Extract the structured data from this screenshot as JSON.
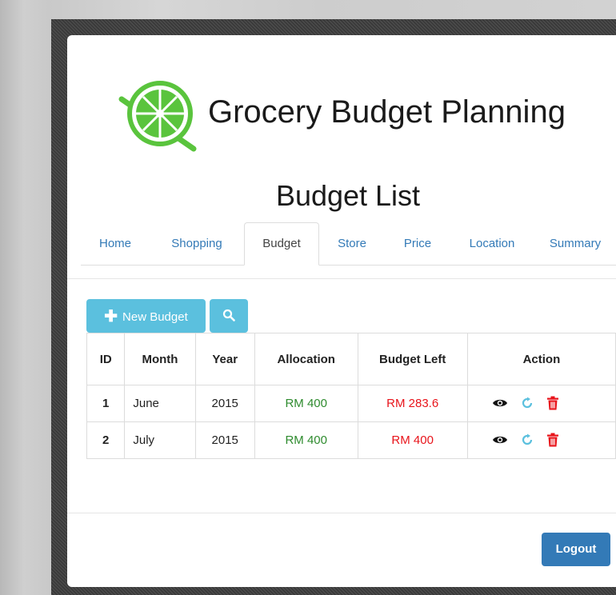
{
  "app": {
    "title": "Grocery Budget Planning"
  },
  "page": {
    "title": "Budget List"
  },
  "tabs": [
    {
      "label": "Home"
    },
    {
      "label": "Shopping"
    },
    {
      "label": "Budget",
      "active": true
    },
    {
      "label": "Store"
    },
    {
      "label": "Price"
    },
    {
      "label": "Location"
    },
    {
      "label": "Summary"
    }
  ],
  "toolbar": {
    "new_label": "New Budget",
    "new_icon": "plus-icon",
    "search_icon": "search-icon"
  },
  "table": {
    "headers": [
      "ID",
      "Month",
      "Year",
      "Allocation",
      "Budget Left",
      "Action"
    ],
    "rows": [
      {
        "id": "1",
        "month": "June",
        "year": "2015",
        "allocation": "RM 400",
        "left": "RM 283.6"
      },
      {
        "id": "2",
        "month": "July",
        "year": "2015",
        "allocation": "RM 400",
        "left": "RM 400"
      }
    ],
    "action_icons": [
      "eye-icon",
      "refresh-icon",
      "trash-icon"
    ]
  },
  "footer": {
    "logout_label": "Logout"
  },
  "colors": {
    "accent": "#5bc0de",
    "primary": "#337ab7",
    "allocation": "#2e8b2e",
    "budget_left": "#e8141b",
    "logo": "#5ac43d"
  }
}
